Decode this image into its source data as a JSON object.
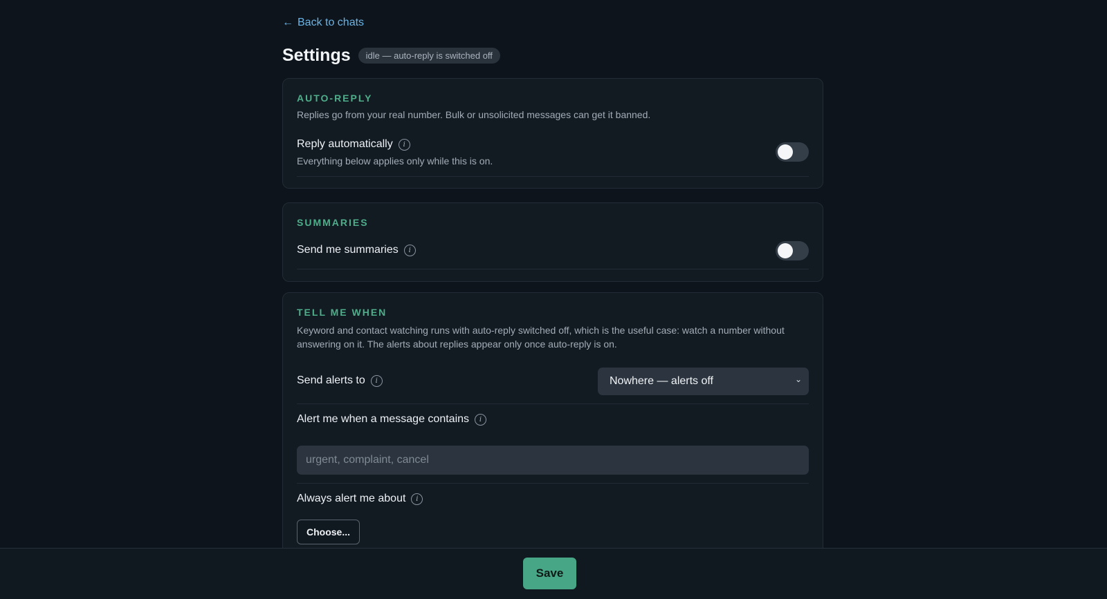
{
  "nav": {
    "back_label": "Back to chats",
    "back_arrow": "←"
  },
  "header": {
    "title": "Settings",
    "status": "idle — auto-reply is switched off"
  },
  "auto_reply": {
    "section_title": "AUTO-REPLY",
    "description": "Replies go from your real number. Bulk or unsolicited messages can get it banned.",
    "reply_label": "Reply automatically",
    "reply_sub": "Everything below applies only while this is on.",
    "reply_enabled": false
  },
  "summaries": {
    "section_title": "SUMMARIES",
    "send_label": "Send me summaries",
    "send_enabled": false
  },
  "tell_me_when": {
    "section_title": "TELL ME WHEN",
    "description": "Keyword and contact watching runs with auto-reply switched off, which is the useful case: watch a number without answering on it. The alerts about replies appear only once auto-reply is on.",
    "send_alerts_label": "Send alerts to",
    "send_alerts_value": "Nowhere — alerts off",
    "keyword_label": "Alert me when a message contains",
    "keyword_placeholder": "urgent, complaint, cancel",
    "keyword_value": "",
    "always_label": "Always alert me about",
    "choose_label": "Choose..."
  },
  "footer": {
    "save_label": "Save"
  },
  "icons": {
    "info": "info-icon",
    "back": "arrow-left-icon",
    "dropdown": "chevron-down-icon"
  },
  "colors": {
    "accent": "#47a685",
    "section_title": "#4fae8a",
    "link": "#6ab4e6",
    "background": "#0d141b"
  }
}
